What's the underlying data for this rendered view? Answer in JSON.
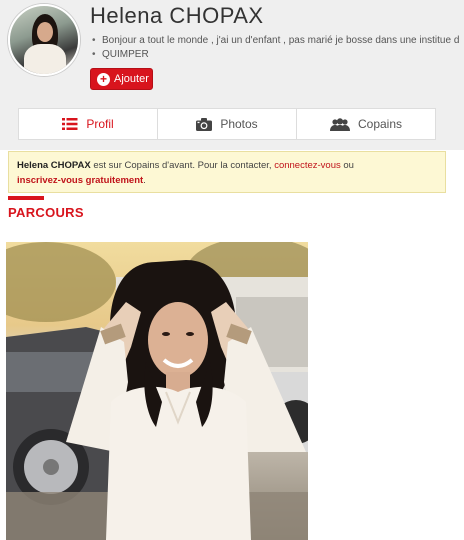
{
  "profile": {
    "name": "Helena CHOPAX",
    "bio_line1": "Bonjour a tout le monde , j'ai un d'enfant , pas marié je bosse dans une institue d",
    "bio_line2": "QUIMPER",
    "add_label": "Ajouter"
  },
  "tabs": [
    {
      "label": "Profil",
      "icon": "list-icon",
      "active": true
    },
    {
      "label": "Photos",
      "icon": "camera-icon",
      "active": false
    },
    {
      "label": "Copains",
      "icon": "users-icon",
      "active": false
    }
  ],
  "notice": {
    "name": "Helena CHOPAX",
    "text1": " est sur Copains d'avant. Pour la contacter, ",
    "login_link": "connectez-vous",
    "text2": " ou",
    "signup_link": "inscrivez-vous gratuitement",
    "text3": "."
  },
  "section": {
    "title": "PARCOURS"
  },
  "colors": {
    "accent": "#d8141d",
    "notice_bg": "#fdf8d4",
    "header_bg": "#efefef"
  }
}
